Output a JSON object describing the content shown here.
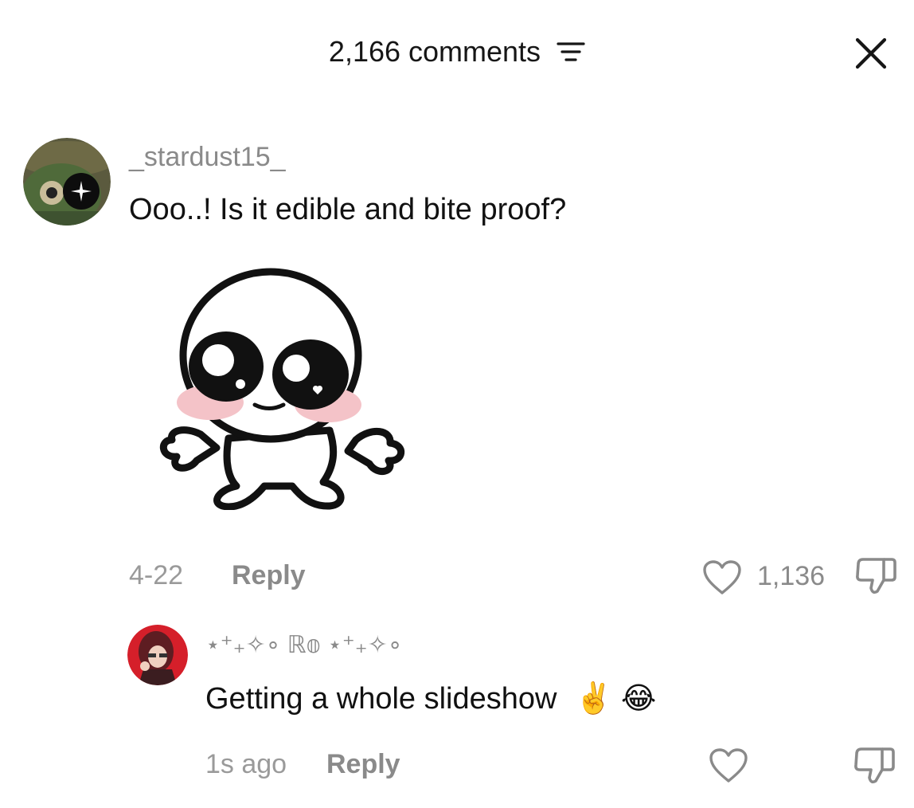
{
  "header": {
    "title": "2,166 comments"
  },
  "comments": [
    {
      "username": "_stardust15_",
      "text": "Ooo..! Is it edible and bite proof?",
      "date": "4-22",
      "reply_label": "Reply",
      "likes": "1,136"
    },
    {
      "username": "⋆⁺₊✧∘ ℝ𝕠 ⋆⁺₊✧∘",
      "text": "Getting a whole slideshow",
      "emoji": "✌️ 😂",
      "date": "1s ago",
      "reply_label": "Reply",
      "likes": ""
    }
  ],
  "icons": {
    "filter": "filter-lines-icon",
    "close": "close-icon",
    "like": "heart-outline-icon",
    "dislike": "thumbs-down-icon"
  },
  "colors": {
    "text": "#111111",
    "muted": "#8a8a8a",
    "blush": "#f4c3c8"
  }
}
